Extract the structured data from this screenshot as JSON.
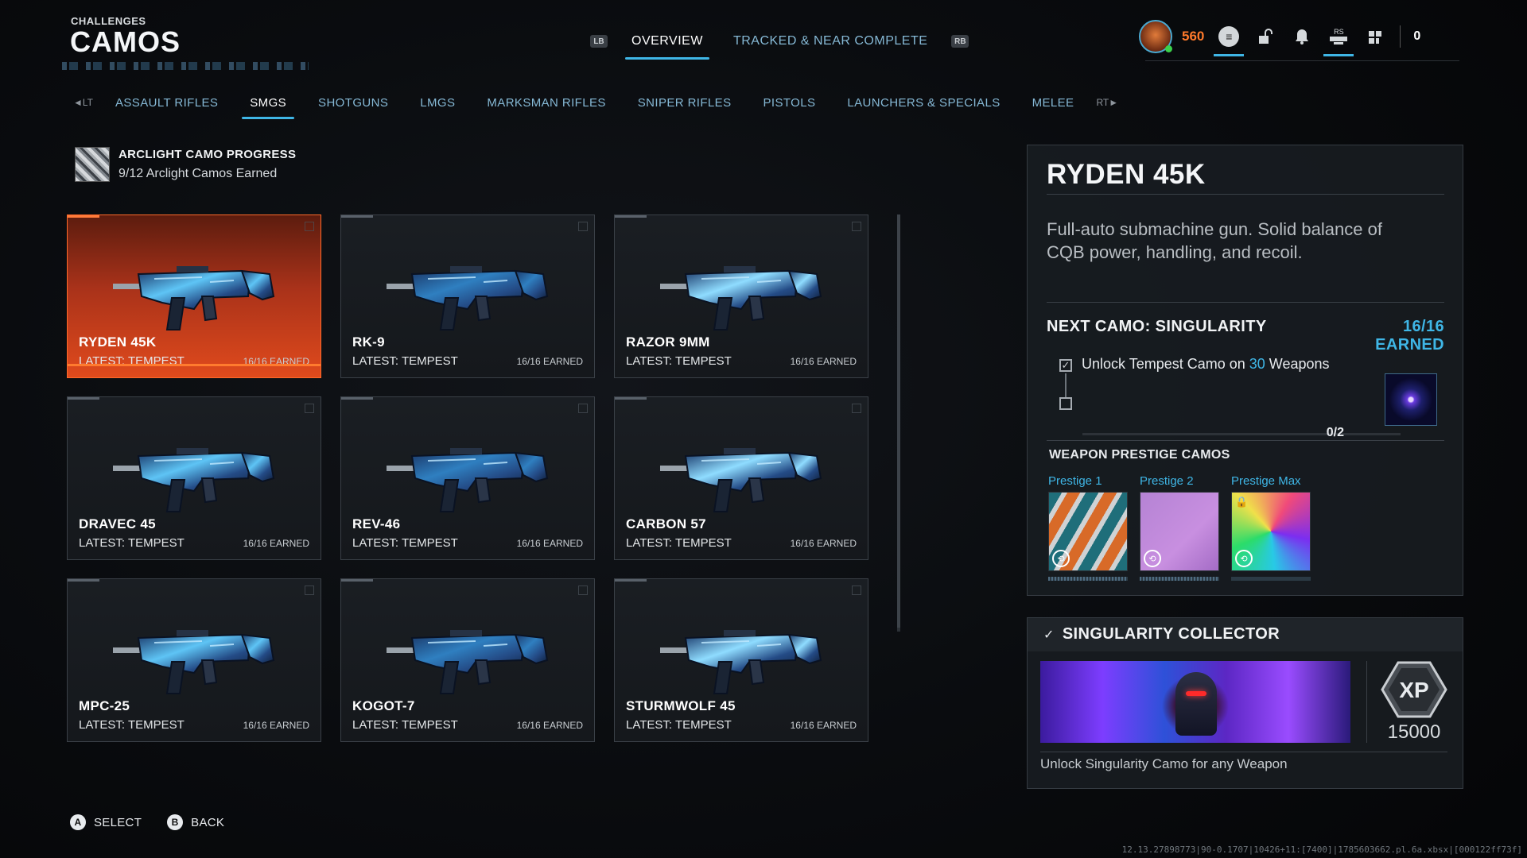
{
  "header": {
    "eyebrow": "CHALLENGES",
    "title": "CAMOS"
  },
  "top_tabs": {
    "left_bumper": "LB",
    "right_bumper": "RB",
    "overview": "OVERVIEW",
    "tracked": "TRACKED & NEAR COMPLETE"
  },
  "hud": {
    "credits": "560",
    "rs_label": "RS",
    "count": "0"
  },
  "categories": [
    "ASSAULT RIFLES",
    "SMGS",
    "SHOTGUNS",
    "LMGS",
    "MARKSMAN RIFLES",
    "SNIPER RIFLES",
    "PISTOLS",
    "LAUNCHERS & SPECIALS",
    "MELEE"
  ],
  "category_active": "SMGS",
  "arclight": {
    "title": "ARCLIGHT CAMO PROGRESS",
    "subtitle": "9/12 Arclight Camos Earned"
  },
  "weapons": [
    {
      "name": "RYDEN 45K",
      "latest": "LATEST: TEMPEST",
      "earned": "16/16 EARNED"
    },
    {
      "name": "RK-9",
      "latest": "LATEST: TEMPEST",
      "earned": "16/16 EARNED"
    },
    {
      "name": "RAZOR 9MM",
      "latest": "LATEST: TEMPEST",
      "earned": "16/16 EARNED"
    },
    {
      "name": "DRAVEC 45",
      "latest": "LATEST: TEMPEST",
      "earned": "16/16 EARNED"
    },
    {
      "name": "REV-46",
      "latest": "LATEST: TEMPEST",
      "earned": "16/16 EARNED"
    },
    {
      "name": "CARBON 57",
      "latest": "LATEST: TEMPEST",
      "earned": "16/16 EARNED"
    },
    {
      "name": "MPC-25",
      "latest": "LATEST: TEMPEST",
      "earned": "16/16 EARNED"
    },
    {
      "name": "KOGOT-7",
      "latest": "LATEST: TEMPEST",
      "earned": "16/16 EARNED"
    },
    {
      "name": "STURMWOLF 45",
      "latest": "LATEST: TEMPEST",
      "earned": "16/16 EARNED"
    }
  ],
  "detail": {
    "title": "RYDEN 45K",
    "description": "Full-auto submachine gun. Solid balance of CQB power, handling, and recoil.",
    "next_camo_label": "NEXT CAMO: SINGULARITY",
    "next_camo_earned": "16/16 EARNED",
    "task_prefix": "Unlock Tempest Camo on ",
    "task_highlight": "30",
    "task_suffix": " Weapons",
    "task_progress": "0/2",
    "prestige_label": "WEAPON PRESTIGE CAMOS",
    "prestige": [
      {
        "name": "Prestige 1",
        "locked": false
      },
      {
        "name": "Prestige 2",
        "locked": false
      },
      {
        "name": "Prestige Max",
        "locked": true
      }
    ]
  },
  "collector": {
    "title": "SINGULARITY COLLECTOR",
    "xp_label": "XP",
    "xp": "15000",
    "description": "Unlock Singularity Camo for any Weapon"
  },
  "footer": {
    "select_key": "A",
    "select": "SELECT",
    "back_key": "B",
    "back": "BACK"
  },
  "build_string": "12.13.27898773|90-0.1707|10426+11:[7400]|1785603662.pl.6a.xbsx|[000122ff73f]",
  "colors": {
    "accent": "#3fb6e6",
    "selected_card": "#e04a1c",
    "credits": "#ff7a2b"
  }
}
